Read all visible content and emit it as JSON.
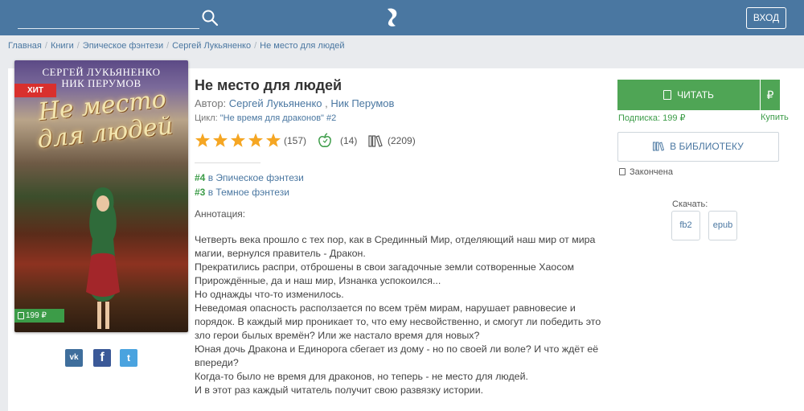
{
  "header": {
    "search": {
      "value": "",
      "placeholder": ""
    },
    "login_label": "ВХОД"
  },
  "breadcrumb": [
    {
      "label": "Главная"
    },
    {
      "label": "Книги"
    },
    {
      "label": "Эпическое фэнтези"
    },
    {
      "label": "Сергей Лукьяненко"
    },
    {
      "label": "Не место для людей"
    }
  ],
  "cover": {
    "author1": "СЕРГЕЙ ЛУКЬЯНЕНКО",
    "author2": "НИК ПЕРУМОВ",
    "title": "Не место для людей",
    "badge": "ХИТ",
    "price": "199 ₽"
  },
  "social": {
    "vk": "vk",
    "fb": "f",
    "tw": "t"
  },
  "book": {
    "title": "Не место для людей",
    "author_prefix": "Автор:",
    "authors": [
      "Сергей Лукьяненко",
      "Ник Перумов"
    ],
    "cycle_prefix": "Цикл:",
    "cycle": "\"Не время для драконов\" #2",
    "rating": 5,
    "rating_count": "(157)",
    "likes_count": "(14)",
    "library_count": "(2209)",
    "ranks": [
      {
        "pos": "#4",
        "text": "в Эпическое фэнтези"
      },
      {
        "pos": "#3",
        "text": "в Темное фэнтези"
      }
    ],
    "annotation_label": "Аннотация:",
    "annotation": [
      "Четверть века прошло с тех пор, как в Срединный Мир, отделяющий наш мир от мира",
      "магии, вернулся правитель - Дракон.",
      "Прекратились распри, отброшены в свои загадочные земли сотворенные Хаосом",
      "Прирождённые, да и наш мир, Изнанка успокоился...",
      "Но однажды что-то изменилось.",
      "Неведомая опасность расползается по всем трём мирам, нарушает равновесие и",
      "порядок. В каждый мир проникает то, что ему несвойственно, и смогут ли победить это",
      "зло герои былых времён? Или же настало время для новых?",
      "Юная дочь Дракона и Единорога сбегает из дому - но по своей ли воле? И что ждёт её",
      "впереди?",
      "Когда-то было не время для драконов, но теперь - не место для людей.",
      "И в этот раз каждый читатель получит свою развязку истории."
    ]
  },
  "actions": {
    "read_label": "ЧИТАТЬ",
    "currency": "₽",
    "subscription": "Подписка: 199 ₽",
    "buy": "Купить",
    "library_label": "В БИБЛИОТЕКУ",
    "status": "Закончена",
    "download_label": "Скачать:",
    "formats": [
      "fb2",
      "epub"
    ]
  },
  "colors": {
    "header": "#4a77a1",
    "accent_green": "#4fa555",
    "link": "#4a77a1"
  }
}
